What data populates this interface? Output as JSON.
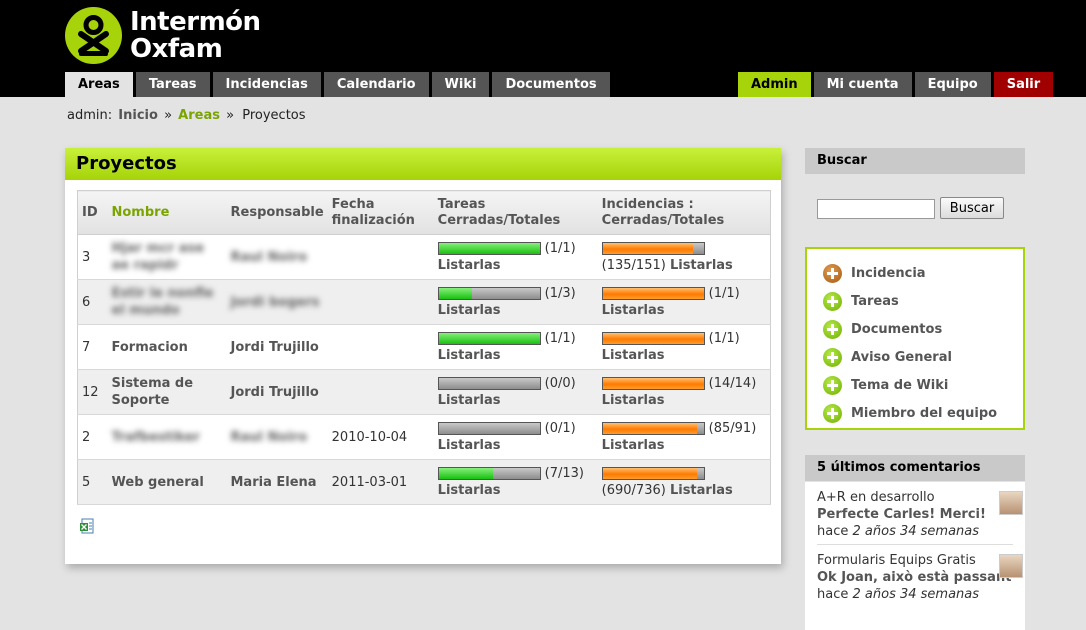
{
  "brand": {
    "line1": "Intermón",
    "line2": "Oxfam",
    "accent": "#a6d309"
  },
  "nav_left": [
    {
      "label": "Areas",
      "active": true
    },
    {
      "label": "Tareas"
    },
    {
      "label": "Incidencias"
    },
    {
      "label": "Calendario"
    },
    {
      "label": "Wiki"
    },
    {
      "label": "Documentos"
    }
  ],
  "nav_right": [
    {
      "label": "Admin"
    },
    {
      "label": "Mi cuenta"
    },
    {
      "label": "Equipo"
    },
    {
      "label": "Salir"
    }
  ],
  "breadcrumb": {
    "user": "admin:",
    "inicio": "Inicio",
    "sep": "»",
    "areas": "Areas",
    "current": "Proyectos"
  },
  "panel": {
    "title": "Proyectos",
    "columns": {
      "id": "ID",
      "nombre": "Nombre",
      "responsable": "Responsable",
      "fecha": "Fecha finalización",
      "tareas": "Tareas Cerradas/Totales",
      "incidencias": "Incidencias : Cerradas/Totales"
    },
    "listar": "Listarlas",
    "rows": [
      {
        "id": "3",
        "nombre": "Hjar mcr ase ae rapidr",
        "responsable": "Raul Noiro",
        "fecha": "",
        "tareas_text": "(1/1)",
        "tareas_fraction": 1.0,
        "inc_text": "(135/151)",
        "inc_fraction": 0.894
      },
      {
        "id": "6",
        "nombre": "Estir le nonfle el mundo",
        "responsable": "Jordi bogers",
        "fecha": "",
        "tareas_text": "(1/3)",
        "tareas_fraction": 0.333,
        "inc_text": "(1/1)",
        "inc_fraction": 1.0
      },
      {
        "id": "7",
        "nombre": "Formacion",
        "responsable": "Jordi Trujillo",
        "fecha": "",
        "tareas_text": "(1/1)",
        "tareas_fraction": 1.0,
        "inc_text": "(1/1)",
        "inc_fraction": 1.0
      },
      {
        "id": "12",
        "nombre": "Sistema de Soporte",
        "responsable": "Jordi Trujillo",
        "fecha": "",
        "tareas_text": "(0/0)",
        "tareas_fraction": 0.0,
        "inc_text": "(14/14)",
        "inc_fraction": 1.0
      },
      {
        "id": "2",
        "nombre": "Trafbestiker",
        "responsable": "Raul Noiro",
        "fecha": "2010-10-04",
        "tareas_text": "(0/1)",
        "tareas_fraction": 0.0,
        "inc_text": "(85/91)",
        "inc_fraction": 0.934
      },
      {
        "id": "5",
        "nombre": "Web general",
        "responsable": "Maria Elena",
        "fecha": "2011-03-01",
        "tareas_text": "(7/13)",
        "tareas_fraction": 0.538,
        "inc_text": "(690/736)",
        "inc_fraction": 0.9375
      }
    ]
  },
  "search": {
    "title": "Buscar",
    "button": "Buscar",
    "value": ""
  },
  "actions": [
    {
      "label": "Incidencia",
      "icon": "plus-brown-icon"
    },
    {
      "label": "Tareas",
      "icon": "plus-green-icon"
    },
    {
      "label": "Documentos",
      "icon": "plus-green-icon"
    },
    {
      "label": "Aviso General",
      "icon": "plus-green-icon"
    },
    {
      "label": "Tema de Wiki",
      "icon": "plus-green-icon"
    },
    {
      "label": "Miembro del equipo",
      "icon": "plus-green-icon"
    }
  ],
  "comments": {
    "title": "5 últimos comentarios",
    "items": [
      {
        "area": "A+R en desarrollo",
        "text": "Perfecte Carles! Merci!",
        "prefix": "hace",
        "when": "2 años 34 semanas"
      },
      {
        "area": "Formularis Equips Gratis",
        "text": "Ok Joan, això està passant",
        "prefix": "hace",
        "when": "2 años 34 semanas"
      }
    ]
  }
}
